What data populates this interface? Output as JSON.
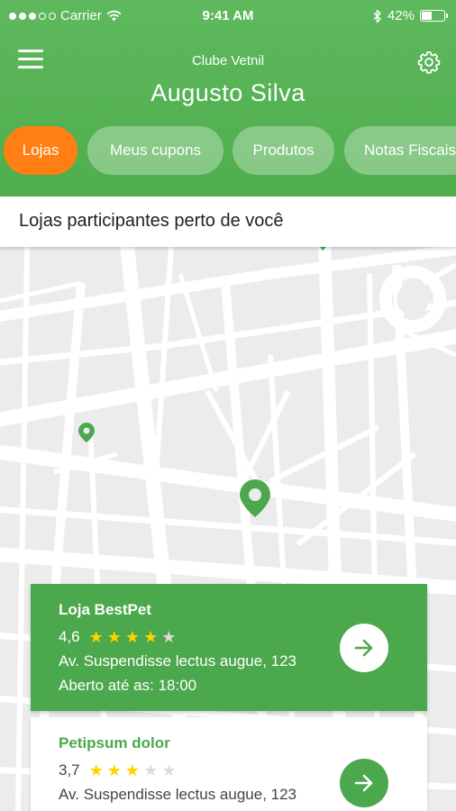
{
  "status_bar": {
    "carrier": "Carrier",
    "time": "9:41 AM",
    "battery_percent": "42%",
    "battery_level": 0.42,
    "icons": [
      "signal-dots-icon",
      "wifi-icon",
      "bluetooth-icon",
      "battery-icon"
    ]
  },
  "header": {
    "app_title": "Clube Vetnil",
    "user_name": "Augusto Silva",
    "icons": [
      "menu-icon",
      "settings-gear-icon"
    ]
  },
  "tabs": [
    {
      "label": "Lojas",
      "active": true
    },
    {
      "label": "Meus cupons",
      "active": false
    },
    {
      "label": "Produtos",
      "active": false
    },
    {
      "label": "Notas Fiscais",
      "active": false
    }
  ],
  "section": {
    "title": "Lojas participantes perto de você"
  },
  "stores": [
    {
      "name": "Loja BestPet",
      "rating": "4,6",
      "stars": 4,
      "address": "Av. Suspendisse lectus augue, 123",
      "hours": "Aberto até as: 18:00",
      "icon": "arrow-right-icon"
    },
    {
      "name": "Petipsum dolor",
      "rating": "3,7",
      "stars": 3,
      "address": "Av. Suspendisse lectus augue, 123",
      "hours": "",
      "icon": "arrow-right-icon"
    }
  ],
  "colors": {
    "primary_green": "#4ca84c",
    "active_tab_orange": "#ff7f14",
    "star_yellow": "#ffd200",
    "map_background": "#ececec"
  }
}
